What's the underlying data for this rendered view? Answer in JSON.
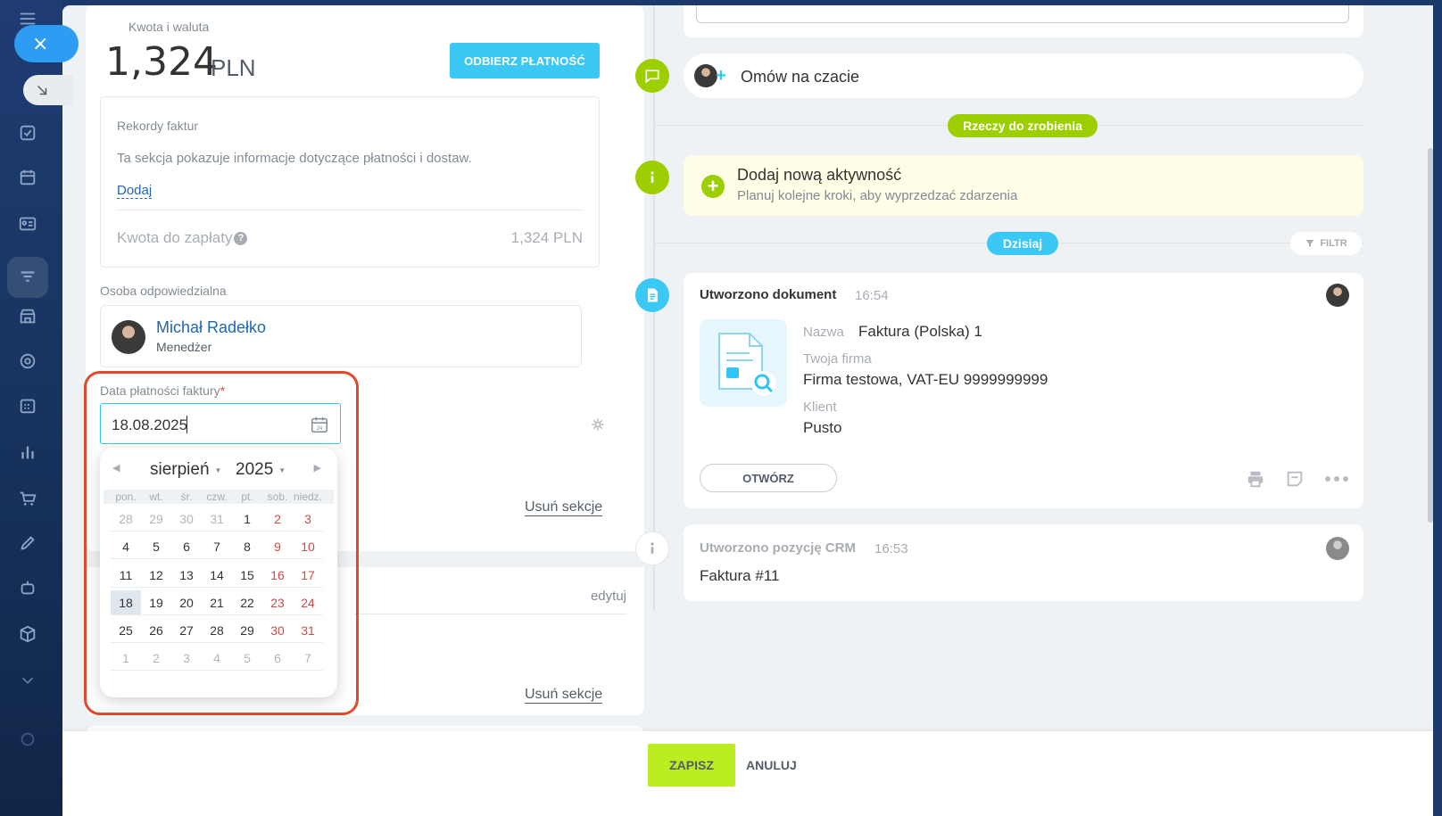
{
  "sidebar": {
    "close_label": "×",
    "icons": [
      "menu-icon",
      "tasks-icon",
      "calendar-icon",
      "contact-card-icon",
      "crm-funnel-icon",
      "store-icon",
      "target-icon",
      "schedule-icon",
      "analytics-icon",
      "cart-icon",
      "edit-icon",
      "robot-icon",
      "box-icon",
      "chevron-down-icon",
      "settings-icon"
    ]
  },
  "payment": {
    "label": "Kwota i waluta",
    "amount": "1,324",
    "currency": "PLN",
    "receive_button": "ODBIERZ PŁATNOŚĆ"
  },
  "invoice_records": {
    "title": "Rekordy faktur",
    "description": "Ta sekcja pokazuje informacje dotyczące płatności i dostaw.",
    "add_link": "Dodaj",
    "due_label": "Kwota do zapłaty",
    "due_value": "1,324 PLN",
    "help_glyph": "?"
  },
  "responsible": {
    "label": "Osoba odpowiedzialna",
    "name": "Michał Radełko",
    "role": "Menedżer"
  },
  "due_date": {
    "label": "Data płatności faktury",
    "required_mark": "*",
    "value": "18.08.2025"
  },
  "datepicker": {
    "month": "sierpień",
    "year": "2025",
    "prev": "◀",
    "next": "▶",
    "weekdays": [
      "pon.",
      "wt.",
      "śr.",
      "czw.",
      "pt.",
      "sob.",
      "niedz."
    ],
    "weeks": [
      [
        "28",
        "29",
        "30",
        "31",
        "1",
        "2",
        "3"
      ],
      [
        "4",
        "5",
        "6",
        "7",
        "8",
        "9",
        "10"
      ],
      [
        "11",
        "12",
        "13",
        "14",
        "15",
        "16",
        "17"
      ],
      [
        "18",
        "19",
        "20",
        "21",
        "22",
        "23",
        "24"
      ],
      [
        "25",
        "26",
        "27",
        "28",
        "29",
        "30",
        "31"
      ],
      [
        "1",
        "2",
        "3",
        "4",
        "5",
        "6",
        "7"
      ]
    ],
    "selected": "18"
  },
  "sections": {
    "remove_label": "Usuń sekcje",
    "edit_label": "edytuj"
  },
  "timeline": {
    "chat_label": "Omów na czacie",
    "todo_badge": "Rzeczy do zrobienia",
    "activity_title": "Dodaj nową aktywność",
    "activity_subtitle": "Planuj kolejne kroki, aby wyprzedzać zdarzenia",
    "today_badge": "Dzisiaj",
    "filter_label": "FILTR",
    "document": {
      "title": "Utworzono dokument",
      "time": "16:54",
      "name_label": "Nazwa",
      "name_value": "Faktura (Polska) 1",
      "company_label": "Twoja firma",
      "company_value": "Firma testowa, VAT-EU 9999999999",
      "client_label": "Klient",
      "client_value": "Pusto",
      "open_button": "OTWÓRZ"
    },
    "crm": {
      "title": "Utworzono pozycję CRM",
      "time": "16:53",
      "text": "Faktura #11"
    }
  },
  "footer": {
    "save": "ZAPISZ",
    "cancel": "ANULUJ"
  },
  "colors": {
    "accent_blue": "#3bc8f5",
    "accent_green": "#9dcf00",
    "save_green": "#bbed21",
    "highlight": "#e0492a"
  }
}
